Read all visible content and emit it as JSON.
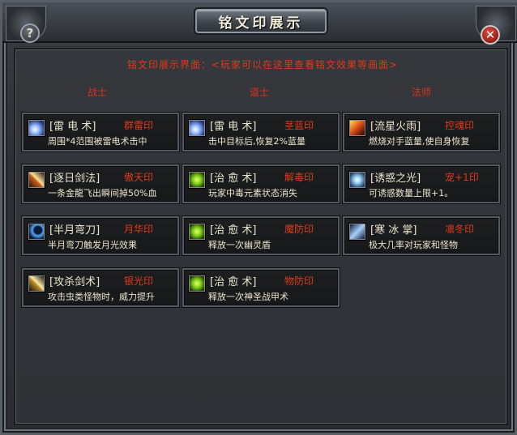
{
  "window": {
    "title": "铭文印展示",
    "help_label": "?",
    "close_label": "✕"
  },
  "intro": "铭文印展示界面：<玩家可以在这里查看铭文效果等画面>",
  "columns": [
    {
      "label": "战士"
    },
    {
      "label": "道士"
    },
    {
      "label": "法师"
    }
  ],
  "cards": [
    {
      "icon": "lightning-icon",
      "skill": "[雷 电 术]",
      "rune": "群雷印",
      "desc": "周围*4范围被雷电术击中"
    },
    {
      "icon": "lightning-icon",
      "skill": "[雷 电 术]",
      "rune": "茎蓝印",
      "desc": "击中目标后,恢复2%蓝量"
    },
    {
      "icon": "meteor-icon",
      "skill": "[流星火雨]",
      "rune": "控魂印",
      "desc": "燃烧对手蓝量,使自身恢复"
    },
    {
      "icon": "sword-slash-icon",
      "skill": "[逐日剑法]",
      "rune": "傲天印",
      "desc": "一条金龍飞出瞬间掉50%血"
    },
    {
      "icon": "heal-icon",
      "skill": "[治 愈 术]",
      "rune": "解毒印",
      "desc": "玩家中毒元素状态消失"
    },
    {
      "icon": "star-burst-icon",
      "skill": "[诱惑之光]",
      "rune": "宠+1印",
      "desc": "可诱惑数量上限+1。"
    },
    {
      "icon": "crescent-blade-icon",
      "skill": "[半月弯刀]",
      "rune": "月华印",
      "desc": "半月弯刀触发月光效果"
    },
    {
      "icon": "heal-icon",
      "skill": "[治 愈 术]",
      "rune": "魔防印",
      "desc": "释放一次幽灵盾"
    },
    {
      "icon": "ice-palm-icon",
      "skill": "[寒 冰 掌]",
      "rune": "凛冬印",
      "desc": "极大几率对玩家和怪物"
    },
    {
      "icon": "sword-icon",
      "skill": "[攻杀剑术]",
      "rune": "银光印",
      "desc": "攻击虫类怪物时，威力提升"
    },
    {
      "icon": "heal-icon",
      "skill": "[治 愈 术]",
      "rune": "物防印",
      "desc": "释放一次神圣战甲术"
    }
  ]
}
